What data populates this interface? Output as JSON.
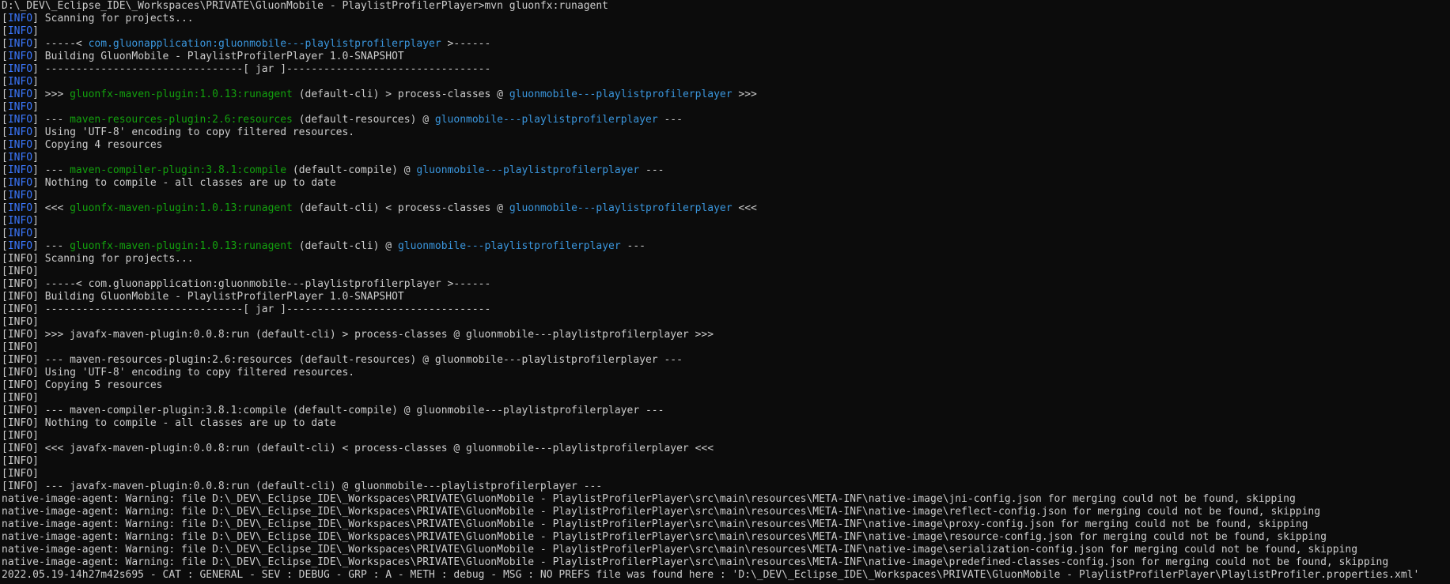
{
  "colors": {
    "background": "#0c0c0c",
    "text": "#cccccc",
    "info_tag": "#3b78ff",
    "plugin_name": "#13a10e",
    "project_id": "#3a96dd"
  },
  "lines": [
    [
      {
        "t": "D:\\_DEV\\_Eclipse_IDE\\_Workspaces\\PRIVATE\\GluonMobile - PlaylistProfilerPlayer>mvn gluonfx:runagent"
      }
    ],
    [
      {
        "t": "["
      },
      {
        "t": "INFO",
        "c": "info"
      },
      {
        "t": "] Scanning for projects..."
      }
    ],
    [
      {
        "t": "["
      },
      {
        "t": "INFO",
        "c": "info"
      },
      {
        "t": "]"
      }
    ],
    [
      {
        "t": "["
      },
      {
        "t": "INFO",
        "c": "info"
      },
      {
        "t": "] -----< "
      },
      {
        "t": "com.gluonapplication:gluonmobile---playlistprofilerplayer",
        "c": "cyan"
      },
      {
        "t": " >------"
      }
    ],
    [
      {
        "t": "["
      },
      {
        "t": "INFO",
        "c": "info"
      },
      {
        "t": "] Building GluonMobile - PlaylistProfilerPlayer 1.0-SNAPSHOT"
      }
    ],
    [
      {
        "t": "["
      },
      {
        "t": "INFO",
        "c": "info"
      },
      {
        "t": "] --------------------------------[ jar ]---------------------------------"
      }
    ],
    [
      {
        "t": "["
      },
      {
        "t": "INFO",
        "c": "info"
      },
      {
        "t": "]"
      }
    ],
    [
      {
        "t": "["
      },
      {
        "t": "INFO",
        "c": "info"
      },
      {
        "t": "] >>> "
      },
      {
        "t": "gluonfx-maven-plugin:1.0.13:runagent",
        "c": "green"
      },
      {
        "t": " (default-cli) > process-classes @ "
      },
      {
        "t": "gluonmobile---playlistprofilerplayer",
        "c": "cyan"
      },
      {
        "t": " >>>"
      }
    ],
    [
      {
        "t": "["
      },
      {
        "t": "INFO",
        "c": "info"
      },
      {
        "t": "]"
      }
    ],
    [
      {
        "t": "["
      },
      {
        "t": "INFO",
        "c": "info"
      },
      {
        "t": "] --- "
      },
      {
        "t": "maven-resources-plugin:2.6:resources",
        "c": "green"
      },
      {
        "t": " (default-resources) @ "
      },
      {
        "t": "gluonmobile---playlistprofilerplayer",
        "c": "cyan"
      },
      {
        "t": " ---"
      }
    ],
    [
      {
        "t": "["
      },
      {
        "t": "INFO",
        "c": "info"
      },
      {
        "t": "] Using 'UTF-8' encoding to copy filtered resources."
      }
    ],
    [
      {
        "t": "["
      },
      {
        "t": "INFO",
        "c": "info"
      },
      {
        "t": "] Copying 4 resources"
      }
    ],
    [
      {
        "t": "["
      },
      {
        "t": "INFO",
        "c": "info"
      },
      {
        "t": "]"
      }
    ],
    [
      {
        "t": "["
      },
      {
        "t": "INFO",
        "c": "info"
      },
      {
        "t": "] --- "
      },
      {
        "t": "maven-compiler-plugin:3.8.1:compile",
        "c": "green"
      },
      {
        "t": " (default-compile) @ "
      },
      {
        "t": "gluonmobile---playlistprofilerplayer",
        "c": "cyan"
      },
      {
        "t": " ---"
      }
    ],
    [
      {
        "t": "["
      },
      {
        "t": "INFO",
        "c": "info"
      },
      {
        "t": "] Nothing to compile - all classes are up to date"
      }
    ],
    [
      {
        "t": "["
      },
      {
        "t": "INFO",
        "c": "info"
      },
      {
        "t": "]"
      }
    ],
    [
      {
        "t": "["
      },
      {
        "t": "INFO",
        "c": "info"
      },
      {
        "t": "] <<< "
      },
      {
        "t": "gluonfx-maven-plugin:1.0.13:runagent",
        "c": "green"
      },
      {
        "t": " (default-cli) < process-classes @ "
      },
      {
        "t": "gluonmobile---playlistprofilerplayer",
        "c": "cyan"
      },
      {
        "t": " <<<"
      }
    ],
    [
      {
        "t": "["
      },
      {
        "t": "INFO",
        "c": "info"
      },
      {
        "t": "]"
      }
    ],
    [
      {
        "t": "["
      },
      {
        "t": "INFO",
        "c": "info"
      },
      {
        "t": "]"
      }
    ],
    [
      {
        "t": "["
      },
      {
        "t": "INFO",
        "c": "info"
      },
      {
        "t": "] --- "
      },
      {
        "t": "gluonfx-maven-plugin:1.0.13:runagent",
        "c": "green"
      },
      {
        "t": " (default-cli) @ "
      },
      {
        "t": "gluonmobile---playlistprofilerplayer",
        "c": "cyan"
      },
      {
        "t": " ---"
      }
    ],
    [
      {
        "t": "[INFO] Scanning for projects..."
      }
    ],
    [
      {
        "t": "[INFO]"
      }
    ],
    [
      {
        "t": "[INFO] -----< com.gluonapplication:gluonmobile---playlistprofilerplayer >------"
      }
    ],
    [
      {
        "t": "[INFO] Building GluonMobile - PlaylistProfilerPlayer 1.0-SNAPSHOT"
      }
    ],
    [
      {
        "t": "[INFO] --------------------------------[ jar ]---------------------------------"
      }
    ],
    [
      {
        "t": "[INFO]"
      }
    ],
    [
      {
        "t": "[INFO] >>> javafx-maven-plugin:0.0.8:run (default-cli) > process-classes @ gluonmobile---playlistprofilerplayer >>>"
      }
    ],
    [
      {
        "t": "[INFO]"
      }
    ],
    [
      {
        "t": "[INFO] --- maven-resources-plugin:2.6:resources (default-resources) @ gluonmobile---playlistprofilerplayer ---"
      }
    ],
    [
      {
        "t": "[INFO] Using 'UTF-8' encoding to copy filtered resources."
      }
    ],
    [
      {
        "t": "[INFO] Copying 5 resources"
      }
    ],
    [
      {
        "t": "[INFO]"
      }
    ],
    [
      {
        "t": "[INFO] --- maven-compiler-plugin:3.8.1:compile (default-compile) @ gluonmobile---playlistprofilerplayer ---"
      }
    ],
    [
      {
        "t": "[INFO] Nothing to compile - all classes are up to date"
      }
    ],
    [
      {
        "t": "[INFO]"
      }
    ],
    [
      {
        "t": "[INFO] <<< javafx-maven-plugin:0.0.8:run (default-cli) < process-classes @ gluonmobile---playlistprofilerplayer <<<"
      }
    ],
    [
      {
        "t": "[INFO]"
      }
    ],
    [
      {
        "t": "[INFO]"
      }
    ],
    [
      {
        "t": "[INFO] --- javafx-maven-plugin:0.0.8:run (default-cli) @ gluonmobile---playlistprofilerplayer ---"
      }
    ],
    [
      {
        "t": "native-image-agent: Warning: file D:\\_DEV\\_Eclipse_IDE\\_Workspaces\\PRIVATE\\GluonMobile - PlaylistProfilerPlayer\\src\\main\\resources\\META-INF\\native-image\\jni-config.json for merging could not be found, skipping"
      }
    ],
    [
      {
        "t": "native-image-agent: Warning: file D:\\_DEV\\_Eclipse_IDE\\_Workspaces\\PRIVATE\\GluonMobile - PlaylistProfilerPlayer\\src\\main\\resources\\META-INF\\native-image\\reflect-config.json for merging could not be found, skipping"
      }
    ],
    [
      {
        "t": "native-image-agent: Warning: file D:\\_DEV\\_Eclipse_IDE\\_Workspaces\\PRIVATE\\GluonMobile - PlaylistProfilerPlayer\\src\\main\\resources\\META-INF\\native-image\\proxy-config.json for merging could not be found, skipping"
      }
    ],
    [
      {
        "t": "native-image-agent: Warning: file D:\\_DEV\\_Eclipse_IDE\\_Workspaces\\PRIVATE\\GluonMobile - PlaylistProfilerPlayer\\src\\main\\resources\\META-INF\\native-image\\resource-config.json for merging could not be found, skipping"
      }
    ],
    [
      {
        "t": "native-image-agent: Warning: file D:\\_DEV\\_Eclipse_IDE\\_Workspaces\\PRIVATE\\GluonMobile - PlaylistProfilerPlayer\\src\\main\\resources\\META-INF\\native-image\\serialization-config.json for merging could not be found, skipping"
      }
    ],
    [
      {
        "t": "native-image-agent: Warning: file D:\\_DEV\\_Eclipse_IDE\\_Workspaces\\PRIVATE\\GluonMobile - PlaylistProfilerPlayer\\src\\main\\resources\\META-INF\\native-image\\predefined-classes-config.json for merging could not be found, skipping"
      }
    ],
    [
      {
        "t": "2022.05.19-14h27m42s695 - CAT : GENERAL - SEV : DEBUG - GRP : A - METH : debug - MSG : NO PREFS file was found here : 'D:\\_DEV\\_Eclipse_IDE\\_Workspaces\\PRIVATE\\GluonMobile - PlaylistProfilerPlayer\\PlaylistProfiler.properties.xml'"
      }
    ]
  ]
}
